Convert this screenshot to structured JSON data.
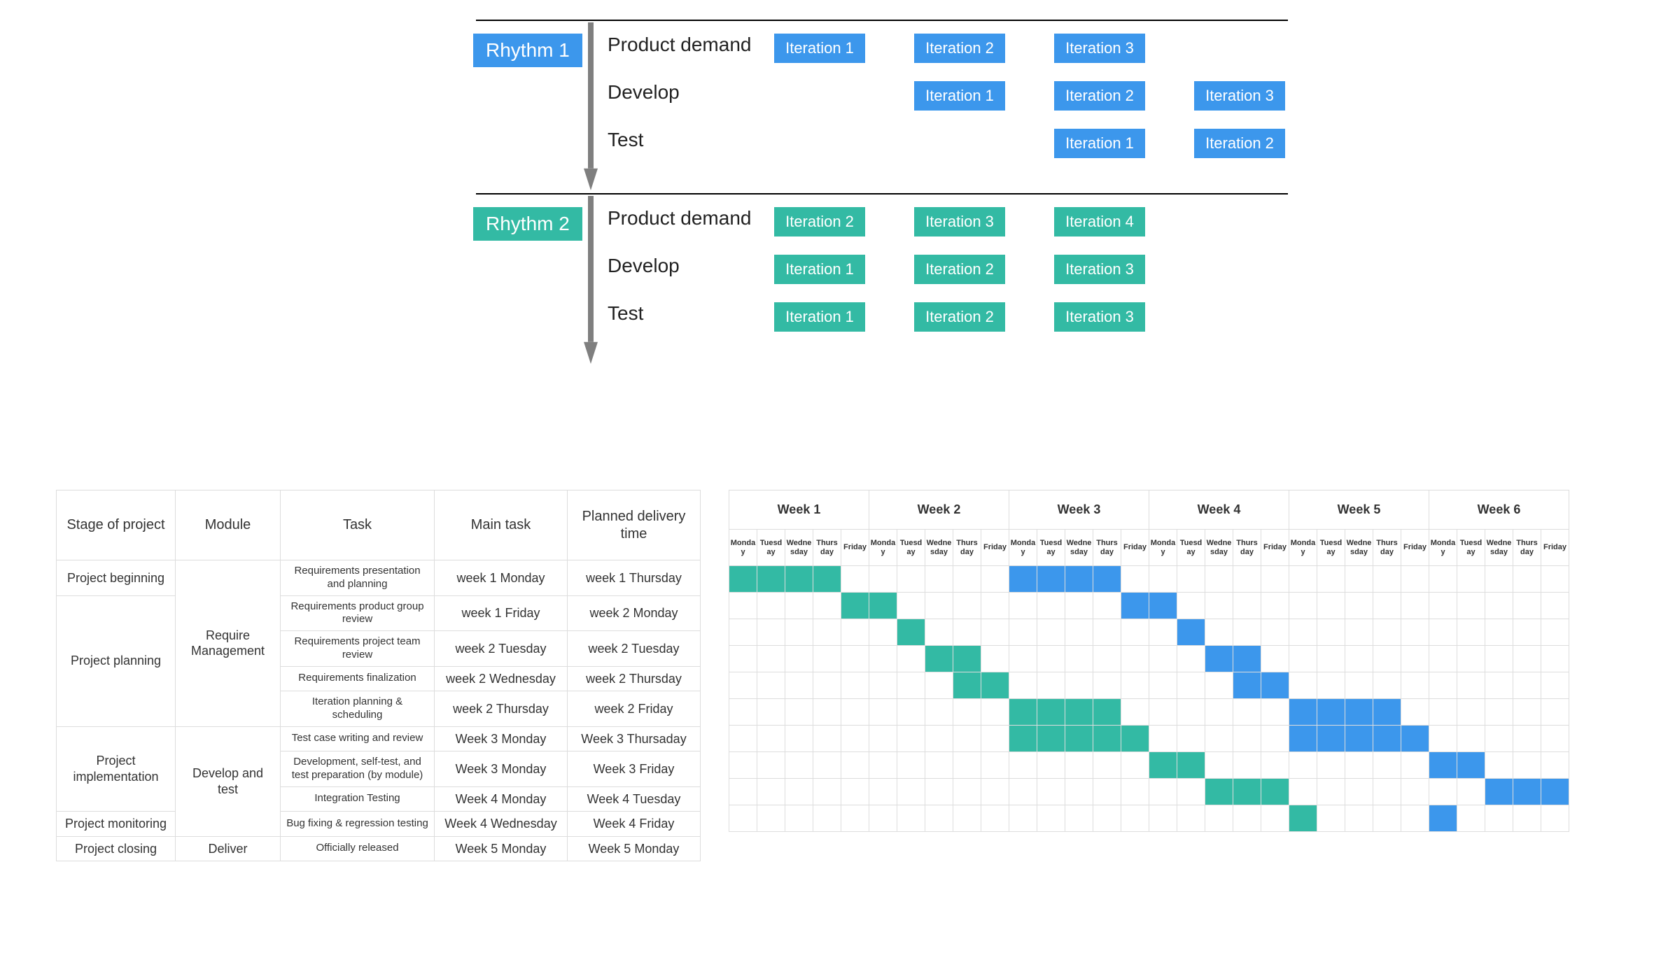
{
  "colors": {
    "blue": "#3c97ec",
    "teal": "#33baa4"
  },
  "rhythm1": {
    "label": "Rhythm 1",
    "rows": [
      {
        "label": "Product demand",
        "boxes": [
          "Iteration 1",
          "Iteration 2",
          "Iteration 3"
        ],
        "positions": [
          0,
          200,
          400
        ],
        "skip": []
      },
      {
        "label": "Develop",
        "boxes": [
          "Iteration 1",
          "Iteration 2",
          "Iteration 3"
        ],
        "positions": [
          200,
          400,
          600
        ],
        "skip": []
      },
      {
        "label": "Test",
        "boxes": [
          "Iteration 1",
          "Iteration 2"
        ],
        "positions": [
          400,
          600
        ],
        "skip": []
      }
    ]
  },
  "rhythm2": {
    "label": "Rhythm 2",
    "rows": [
      {
        "label": "Product demand",
        "boxes": [
          "Iteration 2",
          "Iteration 3",
          "Iteration 4"
        ],
        "positions": [
          0,
          200,
          400
        ]
      },
      {
        "label": "Develop",
        "boxes": [
          "Iteration 1",
          "Iteration 2",
          "Iteration 3"
        ],
        "positions": [
          0,
          200,
          400
        ]
      },
      {
        "label": "Test",
        "boxes": [
          "Iteration 1",
          "Iteration 2",
          "Iteration 3"
        ],
        "positions": [
          0,
          200,
          400
        ]
      }
    ]
  },
  "taskTable": {
    "headers": [
      "Stage of project",
      "Module",
      "Task",
      "Main task",
      "Planned delivery time"
    ],
    "rows": [
      {
        "stage": "Project beginning",
        "module": "Require Management",
        "task": "Requirements presentation and planning",
        "main": "week 1 Monday",
        "deliv": "week 1 Thursday"
      },
      {
        "stage": "Project planning",
        "module": "Require Management",
        "task": "Requirements product group review",
        "main": "week 1 Friday",
        "deliv": "week 2 Monday"
      },
      {
        "stage": "Project planning",
        "module": "Require Management",
        "task": "Requirements project team review",
        "main": "week 2 Tuesday",
        "deliv": "week 2 Tuesday"
      },
      {
        "stage": "Project planning",
        "module": "Require Management",
        "task": "Requirements finalization",
        "main": "week 2 Wednesday",
        "deliv": "week 2 Thursday"
      },
      {
        "stage": "Project planning",
        "module": "Require Management",
        "task": "Iteration planning & scheduling",
        "main": "week 2 Thursday",
        "deliv": "week 2 Friday"
      },
      {
        "stage": "Project implementation",
        "module": "Develop and test",
        "task": "Test case writing and review",
        "main": "Week 3 Monday",
        "deliv": "Week 3 Thursaday"
      },
      {
        "stage": "Project implementation",
        "module": "Develop and test",
        "task": "Development, self-test, and test preparation (by module)",
        "main": "Week 3 Monday",
        "deliv": "Week 3 Friday"
      },
      {
        "stage": "Project implementation",
        "module": "Develop and test",
        "task": "Integration Testing",
        "main": "Week 4 Monday",
        "deliv": "Week 4 Tuesday"
      },
      {
        "stage": "Project monitoring",
        "module": "Develop and test",
        "task": "Bug fixing & regression testing",
        "main": "Week 4 Wednesday",
        "deliv": "Week 4 Friday"
      },
      {
        "stage": "Project closing",
        "module": "Deliver",
        "task": "Officially released",
        "main": "Week 5 Monday",
        "deliv": "Week 5 Monday"
      }
    ],
    "stageSpans": [
      {
        "label": "Project beginning",
        "span": 1
      },
      {
        "label": "Project planning",
        "span": 4
      },
      {
        "label": "Project implementation",
        "span": 3
      },
      {
        "label": "Project monitoring",
        "span": 1
      },
      {
        "label": "Project closing",
        "span": 1
      }
    ],
    "moduleSpans": [
      {
        "label": "Require Management",
        "span": 5
      },
      {
        "label": "Develop and test",
        "span": 4
      },
      {
        "label": "Deliver",
        "span": 1
      }
    ]
  },
  "gantt": {
    "weeks": [
      "Week 1",
      "Week 2",
      "Week 3",
      "Week 4",
      "Week 5",
      "Week 6"
    ],
    "days": [
      "Monday",
      "Tuesday",
      "Wednesday",
      "Thursday",
      "Friday"
    ],
    "bars": [
      {
        "teal": [
          0,
          3
        ],
        "blue": [
          10,
          13
        ]
      },
      {
        "teal": [
          4,
          5
        ],
        "blue": [
          14,
          15
        ]
      },
      {
        "teal": [
          6,
          6
        ],
        "blue": [
          16,
          16
        ]
      },
      {
        "teal": [
          7,
          8
        ],
        "blue": [
          17,
          18
        ]
      },
      {
        "teal": [
          8,
          9
        ],
        "blue": [
          18,
          19
        ]
      },
      {
        "teal": [
          10,
          13
        ],
        "blue": [
          20,
          23
        ]
      },
      {
        "teal": [
          10,
          14
        ],
        "blue": [
          20,
          24
        ]
      },
      {
        "teal": [
          15,
          16
        ],
        "blue": [
          25,
          26
        ]
      },
      {
        "teal": [
          17,
          19
        ],
        "blue": [
          27,
          29
        ]
      },
      {
        "teal": [
          20,
          20
        ],
        "blue": [
          25,
          25
        ]
      }
    ]
  }
}
